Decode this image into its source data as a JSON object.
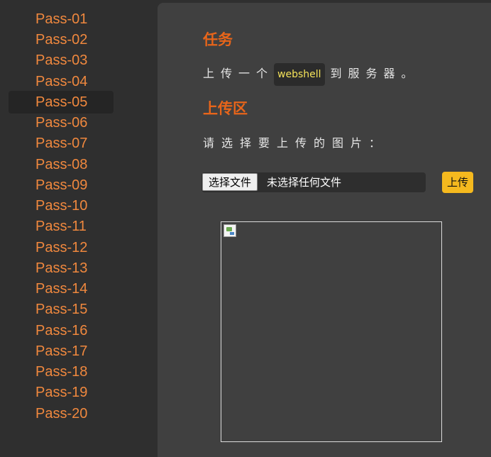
{
  "sidebar": {
    "items": [
      {
        "label": "Pass-01"
      },
      {
        "label": "Pass-02"
      },
      {
        "label": "Pass-03"
      },
      {
        "label": "Pass-04"
      },
      {
        "label": "Pass-05",
        "active": true
      },
      {
        "label": "Pass-06"
      },
      {
        "label": "Pass-07"
      },
      {
        "label": "Pass-08"
      },
      {
        "label": "Pass-09"
      },
      {
        "label": "Pass-10"
      },
      {
        "label": "Pass-11"
      },
      {
        "label": "Pass-12"
      },
      {
        "label": "Pass-13"
      },
      {
        "label": "Pass-14"
      },
      {
        "label": "Pass-15"
      },
      {
        "label": "Pass-16"
      },
      {
        "label": "Pass-17"
      },
      {
        "label": "Pass-18"
      },
      {
        "label": "Pass-19"
      },
      {
        "label": "Pass-20"
      }
    ]
  },
  "task": {
    "title": "任务",
    "text_before": "上传一个",
    "code": "webshell",
    "text_after": "到服务器。"
  },
  "upload": {
    "title": "上传区",
    "prompt": "请选择要上传的图片：",
    "file_button": "选择文件",
    "file_status": "未选择任何文件",
    "submit_label": "上传"
  },
  "colors": {
    "accent": "#e8651a",
    "nav_text": "#f0883e",
    "code_text": "#f5e35a",
    "submit_bg": "#f5b91e"
  },
  "icons": {
    "preview": "broken-image-icon"
  }
}
